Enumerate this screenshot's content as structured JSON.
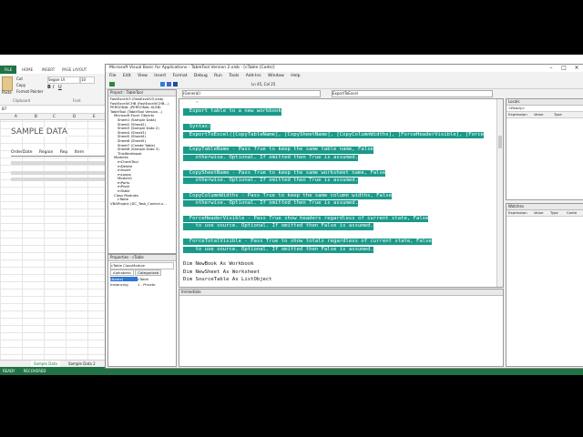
{
  "excel": {
    "file_tab": "FILE",
    "tabs": [
      "HOME",
      "INSERT",
      "PAGE LAYOUT"
    ],
    "font_name": "Segoe UI",
    "font_size": "10",
    "clipboard": {
      "paste": "Paste",
      "cut": "Cut",
      "copy": "Copy",
      "format_painter": "Format Painter",
      "group": "Clipboard",
      "font_group": "Font"
    },
    "name_box": "B7",
    "column_headers": [
      "A",
      "B",
      "C",
      "D",
      "E"
    ],
    "sheet_title": "SAMPLE DATA",
    "table_headers": [
      "OrderDate",
      "Region",
      "Rep",
      "Item"
    ],
    "sheet_tabs": [
      "Sample Data",
      "Sample Data 2"
    ],
    "status": {
      "ready": "READY",
      "recovered": "RECOVERED"
    }
  },
  "vba": {
    "title": "Microsoft Visual Basic for Applications - TableTool Version 2.xlsb - [cTable (Code)]",
    "menu": [
      "File",
      "Edit",
      "View",
      "Insert",
      "Format",
      "Debug",
      "Run",
      "Tools",
      "Add-Ins",
      "Window",
      "Help"
    ],
    "toolbar": {
      "position": "Ln 45, Col 25"
    },
    "project_title": "Project - TableTool",
    "project_tree": [
      "FastExcelV3 (FastExcelV3.xlsb)",
      "FastExcelVCHB (FastExcelVCHB...)",
      "PERSONAL (PERSONAL.XLSB)",
      "TableTool (TableTool Version...)",
      "Microsoft Excel Objects",
      "Sheet1 (Sample Data)",
      "Sheet2 (Sheet2)",
      "Sheet3 (Sample Data 2)",
      "Sheet4 (Sheet3)",
      "Sheet5 (Sheet4)",
      "Sheet6 (Sheet5)",
      "Sheet7 (Create Table)",
      "Sheet8 (Sample Data 3)",
      "ThisWorkbook",
      "Modules",
      "mCheckTool",
      "mDelete",
      "mInsert",
      "mLoops",
      "Module1",
      "mParts",
      "mPivot",
      "mTable",
      "Class Modules",
      "cTable",
      "VBAProject (DC_Task_Control.x..."
    ],
    "properties_title": "Properties - cTable",
    "properties_object": "cTable ClassModule",
    "properties_tabs": [
      "Alphabetic",
      "Categorized"
    ],
    "properties_rows": [
      {
        "name": "(Name)",
        "value": "cTable"
      },
      {
        "name": "Instancing",
        "value": "1 - Private"
      }
    ],
    "object_dropdown": "(General)",
    "proc_dropdown": "ExportToExcel",
    "code_lines": [
      {
        "text": "    '",
        "hl": false
      },
      {
        "text": "  Export table to a new workbook",
        "hl": true
      },
      {
        "text": "",
        "hl": false
      },
      {
        "text": "  Syntax:",
        "hl": true
      },
      {
        "text": "  ExportToExcel([CopyTableName], [CopySheetName], [CopyColumnWidths], [ForceHeaderVisible], [Force",
        "hl": true
      },
      {
        "text": "",
        "hl": false
      },
      {
        "text": "  CopyTableName - Pass True to keep the same table name, False",
        "hl": true
      },
      {
        "text": "    otherwise. Optional. If omitted then True is assumed.",
        "hl": true
      },
      {
        "text": "",
        "hl": false
      },
      {
        "text": "  CopySheetName - Pass True to keep the same worksheet name, False",
        "hl": true
      },
      {
        "text": "    otherwise. Optional. If omitted then True is assumed.",
        "hl": true
      },
      {
        "text": "",
        "hl": false
      },
      {
        "text": "  CopyColumnWidths - Pass True to keep the same column widths, False",
        "hl": true
      },
      {
        "text": "    otherwise. Optional. If omitted then True is assumed.",
        "hl": true
      },
      {
        "text": "",
        "hl": false
      },
      {
        "text": "  ForceHeaderVisible - Pass True show headers regardless of current state, False",
        "hl": true
      },
      {
        "text": "    to use source. Optional. If omitted then False is assumed.",
        "hl": true
      },
      {
        "text": "",
        "hl": false
      },
      {
        "text": "  ForceTotalVisible - Pass True to show totals regardless of current state, False",
        "hl": true
      },
      {
        "text": "    to use source. Optional. If omitted then False is assumed.",
        "hl": true
      },
      {
        "text": "",
        "hl": false
      },
      {
        "text": "Dim NewBook As Workbook",
        "hl": false
      },
      {
        "text": "Dim NewSheet As Worksheet",
        "hl": false
      },
      {
        "text": "Dim SourceTable As ListObject",
        "hl": false
      }
    ],
    "immediate_title": "Immediate",
    "locals_title": "Locals",
    "locals_status": "<Ready>",
    "locals_headers": [
      "Expression",
      "Value",
      "Type"
    ],
    "watches_title": "Watches",
    "watches_headers": [
      "Expression",
      "Value",
      "Type",
      "Conte"
    ]
  }
}
